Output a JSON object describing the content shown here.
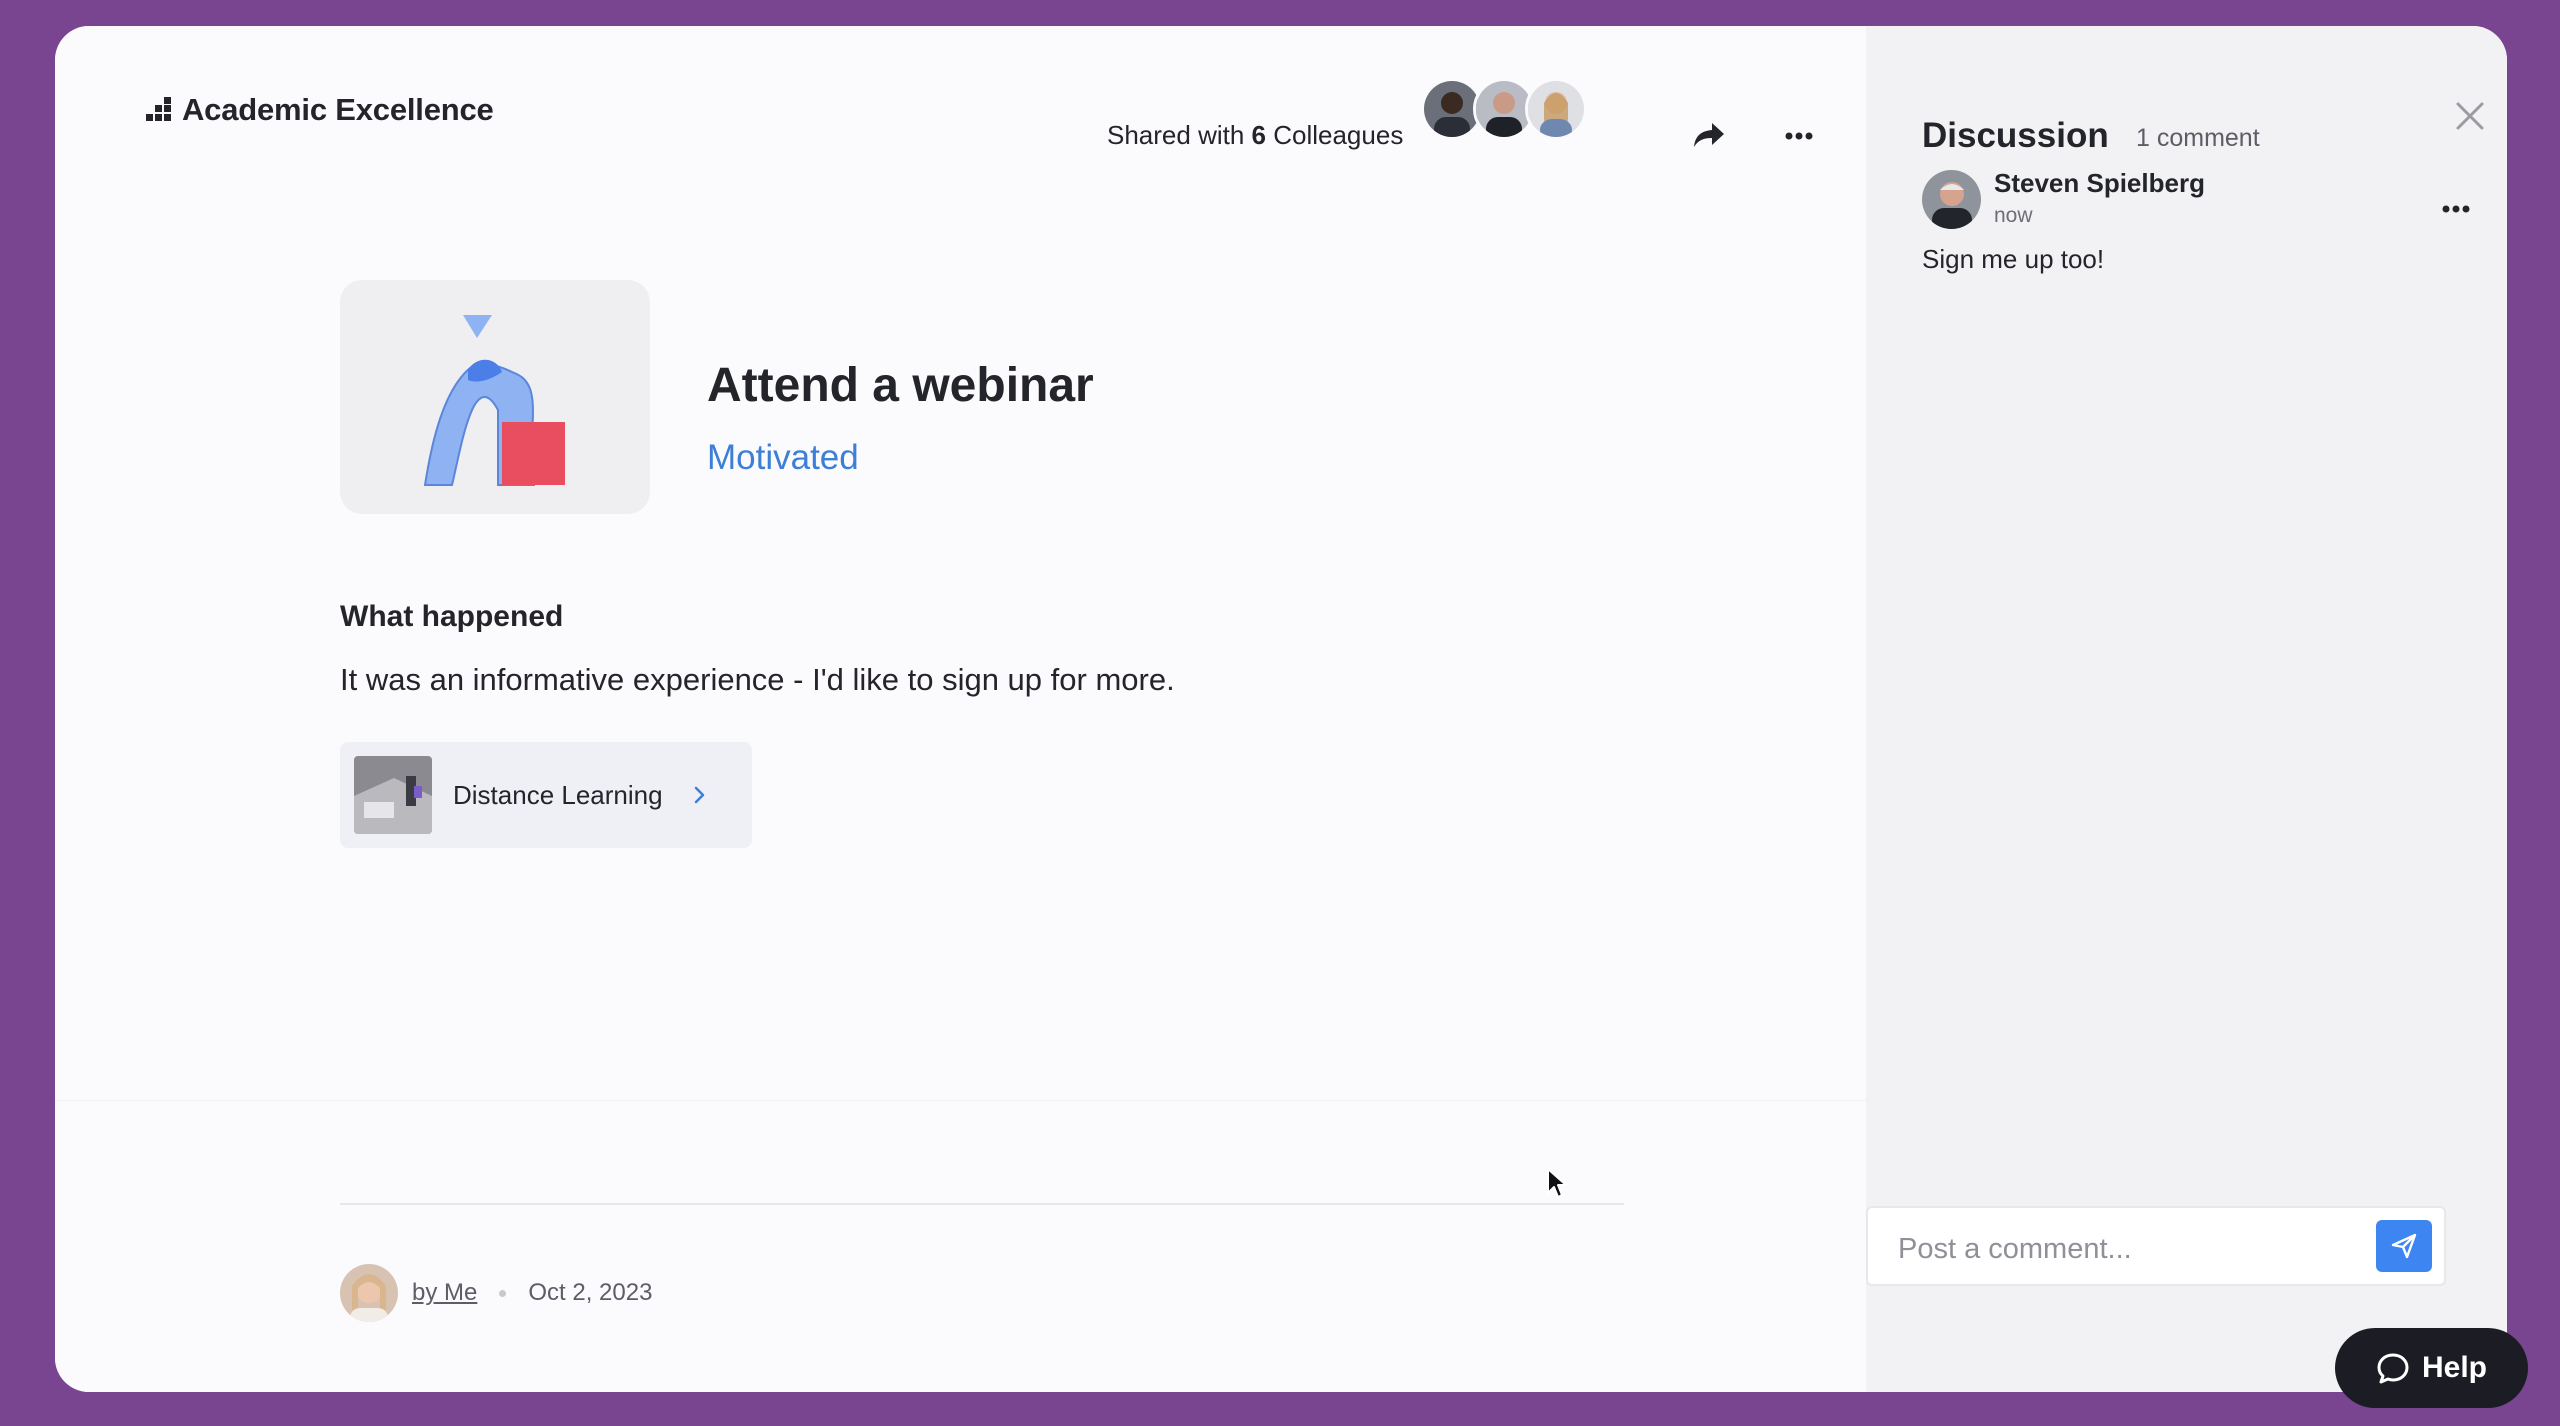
{
  "header": {
    "brand_title": "Academic Excellence",
    "shared_prefix": "Shared with ",
    "shared_count": "6",
    "shared_suffix": " Colleagues",
    "share_icon": "share-arrow-icon",
    "more_icon": "more-horizontal-icon"
  },
  "entry": {
    "title": "Attend a webinar",
    "mood": "Motivated",
    "what_heading": "What happened",
    "what_text": "It was an informative experience - I'd like to sign up for more.",
    "link_label": "Distance Learning"
  },
  "footer": {
    "author": "by Me",
    "date": "Oct 2, 2023"
  },
  "discussion": {
    "title": "Discussion",
    "count": "1 comment",
    "comments": [
      {
        "author": "Steven Spielberg",
        "time": "now",
        "text": "Sign me up too!"
      }
    ],
    "post_placeholder": "Post a comment..."
  },
  "help": {
    "label": "Help"
  },
  "colors": {
    "background": "#7a4590",
    "accent": "#3d7fd6",
    "send_button": "#3d86f2",
    "help_button": "#1b1c24"
  }
}
